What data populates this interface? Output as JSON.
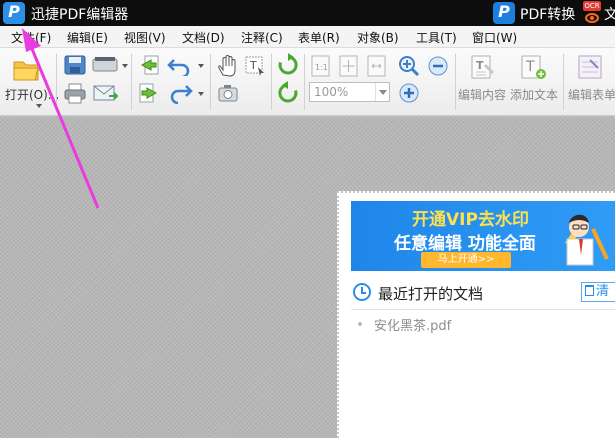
{
  "titlebar": {
    "app_title": "迅捷PDF编辑器",
    "convert_label": "PDF转换",
    "ocr_label": "OCR",
    "cut_text": "文"
  },
  "menu": {
    "items": [
      {
        "id": "file",
        "label": "文件(F)"
      },
      {
        "id": "edit",
        "label": "编辑(E)"
      },
      {
        "id": "view",
        "label": "视图(V)"
      },
      {
        "id": "document",
        "label": "文档(D)"
      },
      {
        "id": "comment",
        "label": "注释(C)"
      },
      {
        "id": "form",
        "label": "表单(R)"
      },
      {
        "id": "object",
        "label": "对象(B)"
      },
      {
        "id": "tools",
        "label": "工具(T)"
      },
      {
        "id": "window",
        "label": "窗口(W)"
      }
    ]
  },
  "toolbar": {
    "open_label": "打开(O)...",
    "zoom_value": "100%",
    "edit_content_label": "编辑内容",
    "add_text_label": "添加文本",
    "edit_form_label": "编辑表单"
  },
  "start_panel": {
    "banner_title": "开通VIP去水印",
    "banner_subtitle": "任意编辑 功能全面",
    "banner_button": "马上开通>>",
    "recent_title": "最近打开的文档",
    "clear_label": "清",
    "recent_files": [
      "安化黑茶.pdf"
    ]
  },
  "colors": {
    "accent": "#2a8fe8",
    "annotation_arrow": "#e93be0",
    "banner_yellow": "#ffe14a",
    "button_orange": "#ffb72e"
  }
}
